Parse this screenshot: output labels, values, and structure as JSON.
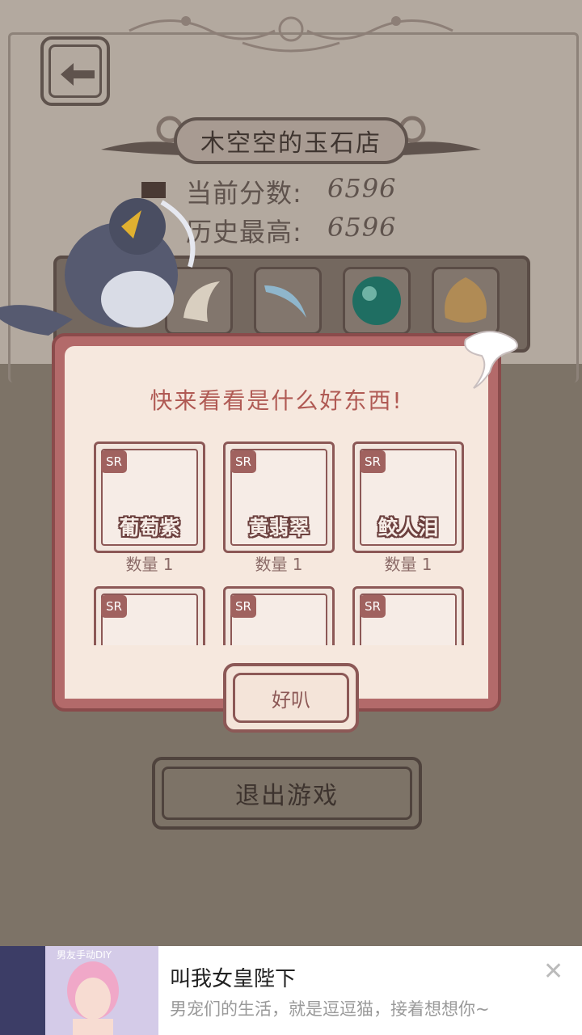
{
  "header": {
    "back_icon": "arrow-left-icon",
    "shop_title": "木空空的玉石店"
  },
  "scores": {
    "current_label": "当前分数:",
    "current_value": "6596",
    "best_label": "历史最高:",
    "best_value": "6596"
  },
  "shelf": {
    "items": [
      "crow-mascot",
      "tooth-item",
      "blue-horn-item",
      "green-orb-item",
      "brown-pouch-item"
    ]
  },
  "dialog": {
    "title": "快来看看是什么好东西!",
    "items": [
      {
        "rarity": "SR",
        "name": "葡萄紫",
        "qty": "数量 1"
      },
      {
        "rarity": "SR",
        "name": "黄翡翠",
        "qty": "数量 1"
      },
      {
        "rarity": "SR",
        "name": "鲛人泪",
        "qty": "数量 1"
      },
      {
        "rarity": "SR",
        "name": "",
        "qty": ""
      },
      {
        "rarity": "SR",
        "name": "",
        "qty": ""
      },
      {
        "rarity": "SR",
        "name": "",
        "qty": ""
      }
    ],
    "ok_label": "好叭"
  },
  "exit_label": "退出游戏",
  "ad": {
    "title": "叫我女皇陛下",
    "description": "男宠们的生活，就是逗逗猫，接着想想你~",
    "image_caption": "男友手动DIY",
    "close_icon": "close-icon"
  },
  "colors": {
    "bg_top": "#b3a99f",
    "bg_dim": "#7d7367",
    "dialog_border": "#b36a6a",
    "dialog_bg": "#f6e8de",
    "accent_text": "#b05a54"
  }
}
